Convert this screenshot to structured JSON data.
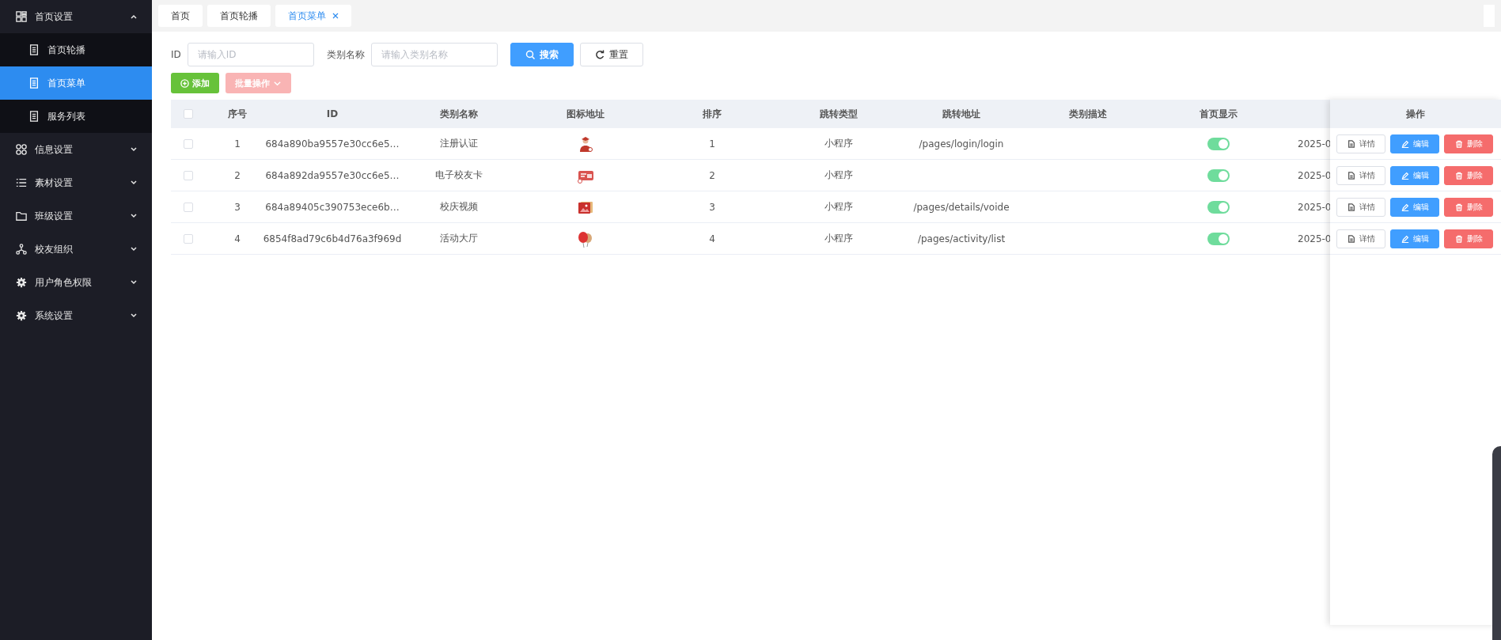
{
  "sidebar": {
    "items": [
      {
        "label": "首页设置",
        "expanded": true,
        "children": [
          {
            "label": "首页轮播",
            "selected": false
          },
          {
            "label": "首页菜单",
            "selected": true
          },
          {
            "label": "服务列表",
            "selected": false
          }
        ]
      },
      {
        "label": "信息设置",
        "expanded": false
      },
      {
        "label": "素材设置",
        "expanded": false
      },
      {
        "label": "班级设置",
        "expanded": false
      },
      {
        "label": "校友组织",
        "expanded": false
      },
      {
        "label": "用户角色权限",
        "expanded": false
      },
      {
        "label": "系统设置",
        "expanded": false
      }
    ]
  },
  "tabs": [
    {
      "label": "首页",
      "selected": false,
      "closable": false
    },
    {
      "label": "首页轮播",
      "selected": false,
      "closable": false
    },
    {
      "label": "首页菜单",
      "selected": true,
      "closable": true
    }
  ],
  "search": {
    "fields": [
      {
        "label": "ID",
        "placeholder": "请输入ID"
      },
      {
        "label": "类别名称",
        "placeholder": "请输入类别名称"
      }
    ],
    "buttons": [
      {
        "label": "搜索",
        "kind": "primary"
      },
      {
        "label": "重置",
        "kind": "reset"
      }
    ]
  },
  "toolbar": [
    {
      "label": "添加",
      "kind": "add",
      "disabled": false
    },
    {
      "label": "批量操作",
      "kind": "batch",
      "disabled": true
    }
  ],
  "table": {
    "all_checked": false,
    "columns": [
      "序号",
      "ID",
      "类别名称",
      "图标地址",
      "排序",
      "跳转类型",
      "跳转地址",
      "类别描述",
      "首页显示"
    ],
    "action_column": "操作",
    "rows": [
      {
        "checked": false,
        "seq": "1",
        "id": "684a890ba9557e30cc6e5…",
        "name": "注册认证",
        "sort": "1",
        "jump_type": "小程序",
        "jump_url": "/pages/login/login",
        "show_home": true,
        "column_10": "2025-0",
        "actions": [
          {
            "label": "详情",
            "kind": "detail"
          },
          {
            "label": "编辑",
            "kind": "edit"
          },
          {
            "label": "删除",
            "kind": "delete"
          }
        ]
      },
      {
        "checked": false,
        "seq": "2",
        "id": "684a892da9557e30cc6e5…",
        "name": "电子校友卡",
        "sort": "2",
        "jump_type": "小程序",
        "show_home": true,
        "column_10": "2025-0",
        "actions": [
          {
            "label": "详情",
            "kind": "detail"
          },
          {
            "label": "编辑",
            "kind": "edit"
          },
          {
            "label": "删除",
            "kind": "delete"
          }
        ]
      },
      {
        "checked": false,
        "seq": "3",
        "id": "684a89405c390753ece6b…",
        "name": "校庆视频",
        "sort": "3",
        "jump_type": "小程序",
        "jump_url": "/pages/details/voide",
        "show_home": true,
        "column_10": "2025-0",
        "actions": [
          {
            "label": "详情",
            "kind": "detail"
          },
          {
            "label": "编辑",
            "kind": "edit"
          },
          {
            "label": "删除",
            "kind": "delete"
          }
        ]
      },
      {
        "checked": false,
        "seq": "4",
        "id": "6854f8ad79c6b4d76a3f969d",
        "name": "活动大厅",
        "sort": "4",
        "jump_type": "小程序",
        "jump_url": "/pages/activity/list",
        "show_home": true,
        "column_10": "2025-0",
        "actions": [
          {
            "label": "详情",
            "kind": "detail"
          },
          {
            "label": "编辑",
            "kind": "edit"
          },
          {
            "label": "删除",
            "kind": "delete"
          }
        ]
      }
    ]
  }
}
